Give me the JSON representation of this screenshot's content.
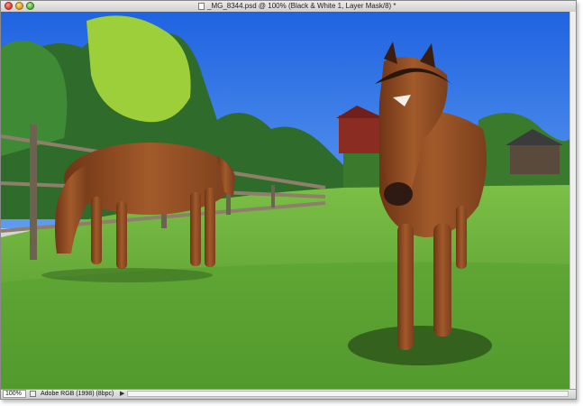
{
  "window": {
    "title": "_MG_8344.psd @ 100% (Black & White 1, Layer Mask/8) *"
  },
  "status": {
    "zoom": "100%",
    "profile": "Adobe RGB (1998) (8bpc)",
    "arrow": "▶"
  },
  "icons": {
    "close": "close-icon",
    "minimize": "minimize-icon",
    "maximize": "maximize-icon",
    "document": "document-icon"
  },
  "colors": {
    "sky": "#2f74e6",
    "grass": "#5fa63a",
    "horse": "#8a4a22"
  }
}
